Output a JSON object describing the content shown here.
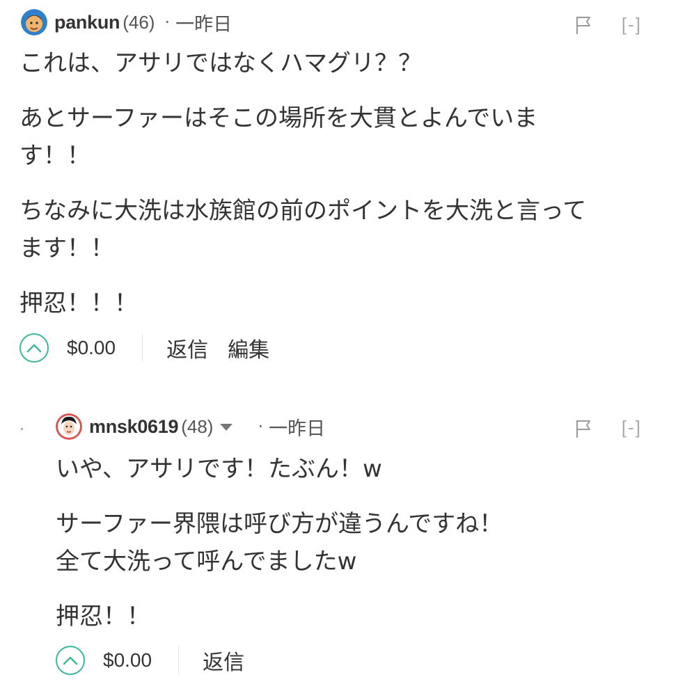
{
  "comments": [
    {
      "author": "pankun",
      "reputation": "(46)",
      "separator": "·",
      "time": "一昨日",
      "collapse_label": "[-]",
      "paragraphs": [
        [
          "これは、アサリではなくハマグリ？？"
        ],
        [
          "あとサーファーはそこの場所を大貫とよんでいま",
          "す！！"
        ],
        [
          "ちなみに大洗は水族館の前のポイントを大洗と言って",
          "ます！！"
        ],
        [
          "押忍！！！"
        ]
      ],
      "payout": "$0.00",
      "reply_label": "返信",
      "edit_label": "編集"
    },
    {
      "author": "mnsk0619",
      "reputation": "(48)",
      "separator": "·",
      "time": "一昨日",
      "collapse_label": "[-]",
      "paragraphs": [
        [
          "いや、アサリです！たぶん！w"
        ],
        [
          "サーファー界隈は呼び方が違うんですね！",
          "全て大洗って呼んでましたw"
        ],
        [
          "押忍！！"
        ]
      ],
      "payout": "$0.00",
      "reply_label": "返信"
    }
  ],
  "colors": {
    "accent": "#3cb79b",
    "text": "#333333",
    "muted": "#aaaaaa"
  },
  "icons": [
    "avatar-pankun",
    "avatar-mnsk0619",
    "flag-icon",
    "upvote-chevron-icon",
    "dropdown-caret-icon"
  ]
}
